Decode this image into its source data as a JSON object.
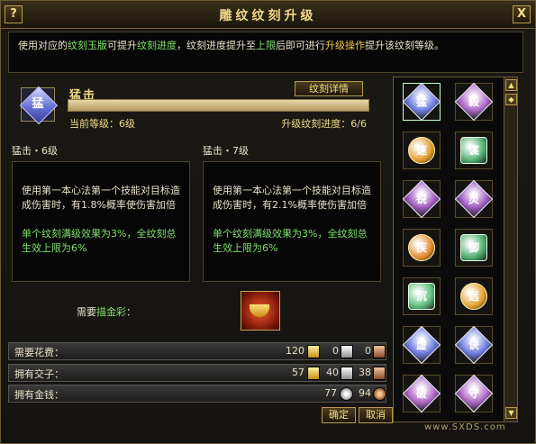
{
  "window": {
    "title": "雕纹纹刻升级",
    "help_label": "?",
    "close_label": "X"
  },
  "description": {
    "part1": "使用对应的",
    "hl1": "纹刻玉版",
    "part2": "可提升",
    "hl2": "纹刻进度",
    "part3": "，纹刻进度提升至",
    "hl3": "上限",
    "part4": "后即可进行",
    "hl4": "升级操作",
    "part5": "提升该纹刻等级。"
  },
  "skill": {
    "icon": "rune-gem-icon",
    "icon_char": "猛",
    "name": "猛击",
    "detail_button": "纹刻详情",
    "current_level_label": "当前等级：6级",
    "progress_label": "升级纹刻进度：6/6",
    "progress": 1.0
  },
  "current": {
    "title": "猛击・6级",
    "effect": "使用第一本心法第一个技能对目标造成伤害时，有1.8%概率使伤害加倍",
    "cap": "单个纹刻满级效果为3%，全纹刻总生效上限为6%"
  },
  "next": {
    "title": "猛击・7级",
    "effect": "使用第一本心法第一个技能对目标造成伤害时，有2.1%概率使伤害加倍",
    "cap": "单个纹刻满级效果为3%，全纹刻总生效上限为6%"
  },
  "requirement": {
    "prefix": "需要",
    "item": "描金彩",
    "suffix": "：",
    "item_icon": "gold-bowl-icon"
  },
  "costs": [
    {
      "label": "需要花费：",
      "gold": "120",
      "silver": "0",
      "copper": "0"
    },
    {
      "label": "拥有交子：",
      "gold": "57",
      "silver": "40",
      "copper": "38"
    }
  ],
  "money": {
    "label": "拥有金钱：",
    "silver": "77",
    "copper": "94"
  },
  "buttons": {
    "confirm": "确定",
    "cancel": "取消"
  },
  "runes": [
    {
      "char": "猛",
      "shape": "diamond",
      "color": "#6f7ee0"
    },
    {
      "char": "毅",
      "shape": "diamond",
      "color": "#b06ac8"
    },
    {
      "char": "速",
      "shape": "circle",
      "color": "#e39a2a"
    },
    {
      "char": "谋",
      "shape": "square",
      "color": "#4fb070"
    },
    {
      "char": "锐",
      "shape": "diamond",
      "color": "#a05ac0"
    },
    {
      "char": "灵",
      "shape": "diamond",
      "color": "#a05ac0"
    },
    {
      "char": "疾",
      "shape": "circle",
      "color": "#e38a2a"
    },
    {
      "char": "御",
      "shape": "square",
      "color": "#4fb070"
    },
    {
      "char": "沉",
      "shape": "square",
      "color": "#5fc080"
    },
    {
      "char": "远",
      "shape": "circle",
      "color": "#e3a02a"
    },
    {
      "char": "虚",
      "shape": "diamond",
      "color": "#6f7ee0"
    },
    {
      "char": "诀",
      "shape": "diamond",
      "color": "#6f7ee0"
    },
    {
      "char": "破",
      "shape": "diamond",
      "color": "#b06ac8"
    },
    {
      "char": "守",
      "shape": "diamond",
      "color": "#b06ac8"
    }
  ],
  "scroll": {
    "up": "▲",
    "thumb": "◆",
    "down": "▼"
  },
  "watermark": "www.SXDS.com"
}
